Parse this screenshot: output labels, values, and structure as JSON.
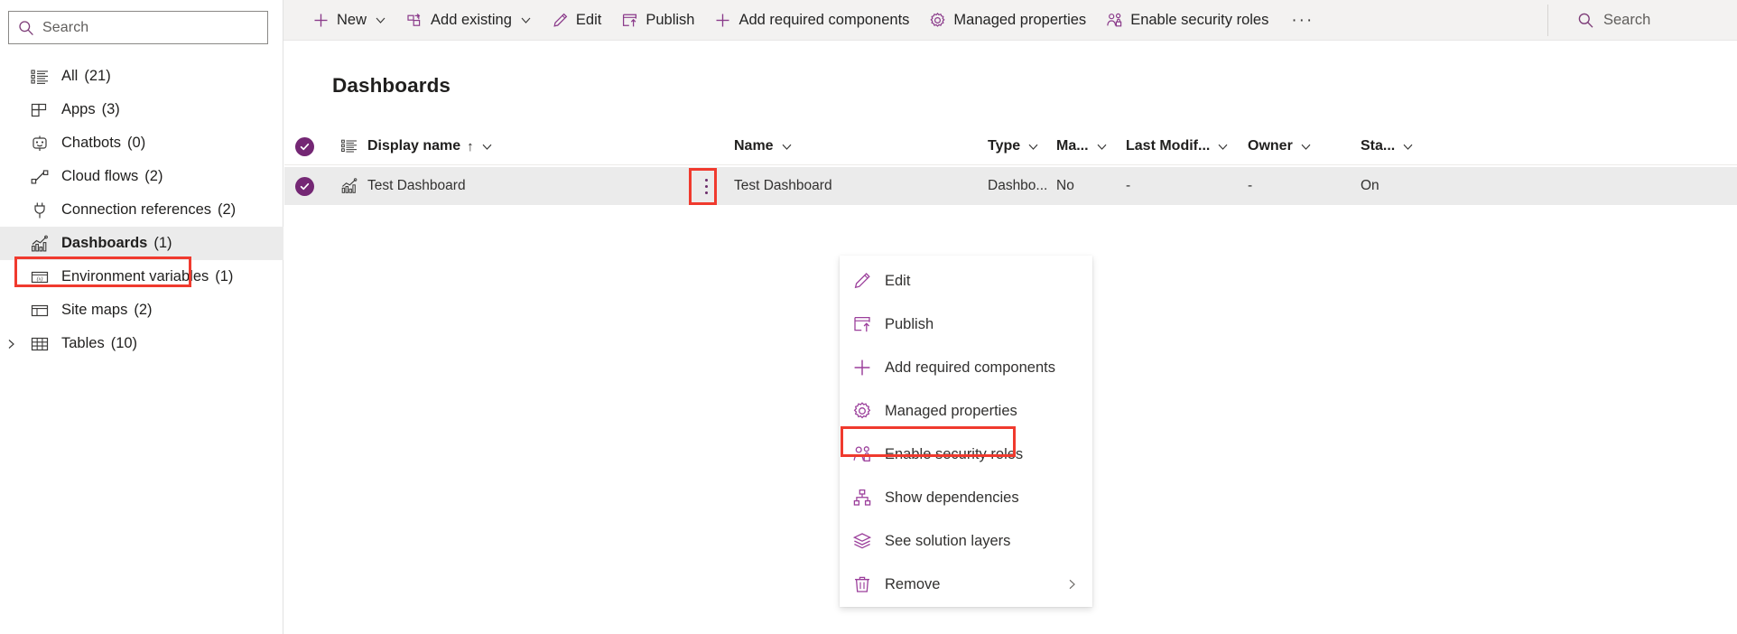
{
  "sidebar": {
    "search": {
      "placeholder": "Search",
      "icon": "search-icon"
    },
    "items": [
      {
        "label": "All",
        "count": "(21)",
        "icon": "list-icon",
        "selected": false,
        "expandable": false
      },
      {
        "label": "Apps",
        "count": "(3)",
        "icon": "apps-grid-icon",
        "selected": false,
        "expandable": false
      },
      {
        "label": "Chatbots",
        "count": "(0)",
        "icon": "chatbot-icon",
        "selected": false,
        "expandable": false
      },
      {
        "label": "Cloud flows",
        "count": "(2)",
        "icon": "cloud-flow-icon",
        "selected": false,
        "expandable": false
      },
      {
        "label": "Connection references",
        "count": "(2)",
        "icon": "plug-icon",
        "selected": false,
        "expandable": false
      },
      {
        "label": "Dashboards",
        "count": "(1)",
        "icon": "dashboard-chart-icon",
        "selected": true,
        "expandable": false
      },
      {
        "label": "Environment variables",
        "count": "(1)",
        "icon": "variable-icon",
        "selected": false,
        "expandable": false
      },
      {
        "label": "Site maps",
        "count": "(2)",
        "icon": "sitemap-layout-icon",
        "selected": false,
        "expandable": false
      },
      {
        "label": "Tables",
        "count": "(10)",
        "icon": "table-grid-icon",
        "selected": false,
        "expandable": true
      }
    ]
  },
  "commandbar": {
    "items": [
      {
        "label": "New",
        "icon": "plus-icon",
        "caret": true
      },
      {
        "label": "Add existing",
        "icon": "add-existing-icon",
        "caret": true
      },
      {
        "label": "Edit",
        "icon": "pencil-icon",
        "caret": false
      },
      {
        "label": "Publish",
        "icon": "publish-icon",
        "caret": false
      },
      {
        "label": "Add required components",
        "icon": "plus-icon",
        "caret": false
      },
      {
        "label": "Managed properties",
        "icon": "gear-icon",
        "caret": false
      },
      {
        "label": "Enable security roles",
        "icon": "security-roles-icon",
        "caret": false
      }
    ],
    "overflow_label": "···",
    "search": {
      "placeholder": "Search",
      "icon": "search-icon"
    }
  },
  "main": {
    "title": "Dashboards",
    "table": {
      "columns": [
        {
          "key": "select",
          "label": "",
          "icon": "select-all-checked-icon",
          "sortable": false
        },
        {
          "key": "typeicon",
          "label": "",
          "icon": "list-icon",
          "sortable": false
        },
        {
          "key": "display_name",
          "label": "Display name",
          "sort": "↑",
          "caret": true
        },
        {
          "key": "name",
          "label": "Name",
          "caret": true
        },
        {
          "key": "type",
          "label": "Type",
          "caret": true
        },
        {
          "key": "managed",
          "label": "Ma...",
          "caret": true
        },
        {
          "key": "last_modified",
          "label": "Last Modif...",
          "caret": true
        },
        {
          "key": "owner",
          "label": "Owner",
          "caret": true
        },
        {
          "key": "status",
          "label": "Sta...",
          "caret": true
        }
      ],
      "rows": [
        {
          "selected": true,
          "row_icon": "dashboard-chart-icon",
          "display_name": "Test Dashboard",
          "name": "Test Dashboard",
          "type": "Dashbo...",
          "managed": "No",
          "last_modified": "-",
          "owner": "-",
          "status": "On"
        }
      ]
    }
  },
  "context_menu": {
    "items": [
      {
        "label": "Edit",
        "icon": "pencil-icon",
        "submenu": false,
        "highlighted": false
      },
      {
        "label": "Publish",
        "icon": "publish-icon",
        "submenu": false,
        "highlighted": false
      },
      {
        "label": "Add required components",
        "icon": "plus-icon",
        "submenu": false,
        "highlighted": false
      },
      {
        "label": "Managed properties",
        "icon": "gear-icon",
        "submenu": false,
        "highlighted": false
      },
      {
        "label": "Enable security roles",
        "icon": "security-roles-icon",
        "submenu": false,
        "highlighted": true
      },
      {
        "label": "Show dependencies",
        "icon": "dependencies-icon",
        "submenu": false,
        "highlighted": false
      },
      {
        "label": "See solution layers",
        "icon": "layers-icon",
        "submenu": false,
        "highlighted": false
      },
      {
        "label": "Remove",
        "icon": "trash-icon",
        "submenu": true,
        "highlighted": false
      }
    ]
  },
  "colors": {
    "accent_purple": "#742774",
    "icon_purple": "#9b3f9b",
    "highlight_red": "#f03a2e",
    "row_selected_bg": "#ebebeb",
    "commandbar_bg": "#f3f2f1",
    "text_primary": "#201f1e"
  }
}
